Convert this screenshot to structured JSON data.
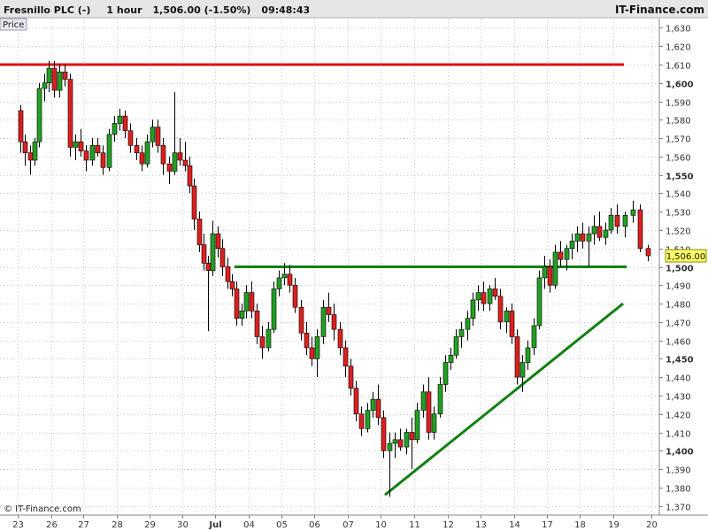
{
  "header": {
    "instrument": "Fresnillo PLC (-)",
    "timeframe": "1 hour",
    "last_price": "1,506.00 (-1.50%)",
    "time": "09:48:43",
    "brand": "IT-Finance.com"
  },
  "panel_label": "Price",
  "watermark": "© IT-Finance.com",
  "price_badge": "1,506.00",
  "colors": {
    "up_candle": "#22a022",
    "down_candle": "#dd2020",
    "resistance_line": "#e01010",
    "support_line": "#108010",
    "trend_line": "#108010",
    "grid": "#c8c8c8",
    "axis_text": "#333333"
  },
  "chart_data": {
    "type": "candlestick",
    "ylim": [
      1365,
      1635
    ],
    "y_ticks": [
      {
        "value": 1370,
        "label": "1,370",
        "bold": false
      },
      {
        "value": 1380,
        "label": "1,380",
        "bold": false
      },
      {
        "value": 1390,
        "label": "1,390",
        "bold": false
      },
      {
        "value": 1400,
        "label": "1,400",
        "bold": true
      },
      {
        "value": 1410,
        "label": "1,410",
        "bold": false
      },
      {
        "value": 1420,
        "label": "1,420",
        "bold": false
      },
      {
        "value": 1430,
        "label": "1,430",
        "bold": false
      },
      {
        "value": 1440,
        "label": "1,440",
        "bold": false
      },
      {
        "value": 1450,
        "label": "1,450",
        "bold": true
      },
      {
        "value": 1460,
        "label": "1,460",
        "bold": false
      },
      {
        "value": 1470,
        "label": "1,470",
        "bold": false
      },
      {
        "value": 1480,
        "label": "1,480",
        "bold": false
      },
      {
        "value": 1490,
        "label": "1,490",
        "bold": false
      },
      {
        "value": 1500,
        "label": "1,500",
        "bold": true
      },
      {
        "value": 1510,
        "label": "1,510",
        "bold": false
      },
      {
        "value": 1520,
        "label": "1,520",
        "bold": false
      },
      {
        "value": 1530,
        "label": "1,530",
        "bold": false
      },
      {
        "value": 1540,
        "label": "1,540",
        "bold": false
      },
      {
        "value": 1550,
        "label": "1,550",
        "bold": true
      },
      {
        "value": 1560,
        "label": "1,560",
        "bold": false
      },
      {
        "value": 1570,
        "label": "1,570",
        "bold": false
      },
      {
        "value": 1580,
        "label": "1,580",
        "bold": false
      },
      {
        "value": 1590,
        "label": "1,590",
        "bold": false
      },
      {
        "value": 1600,
        "label": "1,600",
        "bold": true
      },
      {
        "value": 1610,
        "label": "1,610",
        "bold": false
      },
      {
        "value": 1620,
        "label": "1,620",
        "bold": false
      },
      {
        "value": 1630,
        "label": "1,630",
        "bold": false
      }
    ],
    "x_labels": [
      "23",
      "26",
      "27",
      "28",
      "29",
      "30",
      "Jul",
      "04",
      "05",
      "06",
      "07",
      "10",
      "11",
      "12",
      "13",
      "14",
      "17",
      "18",
      "19",
      "20"
    ],
    "sessions": [
      {
        "label": "23",
        "ohlc": [
          [
            1585,
            1588,
            1562,
            1568
          ],
          [
            1568,
            1572,
            1555,
            1562
          ],
          [
            1562,
            1566,
            1550,
            1558
          ],
          [
            1558,
            1570,
            1555,
            1568
          ],
          [
            1568,
            1600,
            1565,
            1597
          ],
          [
            1597,
            1605,
            1590,
            1600
          ],
          [
            1600,
            1612,
            1595,
            1608
          ]
        ]
      },
      {
        "label": "26",
        "ohlc": [
          [
            1608,
            1612,
            1592,
            1596
          ],
          [
            1596,
            1610,
            1592,
            1606
          ],
          [
            1606,
            1610,
            1598,
            1602
          ],
          [
            1602,
            1605,
            1560,
            1565
          ],
          [
            1565,
            1572,
            1558,
            1568
          ],
          [
            1568,
            1575,
            1560,
            1563
          ]
        ]
      },
      {
        "label": "27",
        "ohlc": [
          [
            1563,
            1566,
            1552,
            1558
          ],
          [
            1558,
            1570,
            1555,
            1566
          ],
          [
            1566,
            1570,
            1560,
            1562
          ],
          [
            1562,
            1566,
            1550,
            1554
          ],
          [
            1554,
            1575,
            1552,
            1572
          ],
          [
            1572,
            1582,
            1568,
            1578
          ]
        ]
      },
      {
        "label": "28",
        "ohlc": [
          [
            1578,
            1586,
            1574,
            1582
          ],
          [
            1582,
            1585,
            1570,
            1574
          ],
          [
            1574,
            1578,
            1562,
            1566
          ],
          [
            1566,
            1570,
            1558,
            1562
          ],
          [
            1562,
            1566,
            1552,
            1556
          ],
          [
            1556,
            1572,
            1554,
            1568
          ]
        ]
      },
      {
        "label": "29",
        "ohlc": [
          [
            1568,
            1580,
            1565,
            1576
          ],
          [
            1576,
            1580,
            1562,
            1566
          ],
          [
            1566,
            1570,
            1550,
            1556
          ],
          [
            1556,
            1560,
            1545,
            1552
          ],
          [
            1552,
            1595,
            1550,
            1562
          ],
          [
            1562,
            1570,
            1555,
            1558
          ]
        ]
      },
      {
        "label": "30",
        "ohlc": [
          [
            1558,
            1568,
            1552,
            1555
          ],
          [
            1555,
            1560,
            1540,
            1544
          ],
          [
            1544,
            1548,
            1520,
            1526
          ],
          [
            1526,
            1530,
            1508,
            1512
          ],
          [
            1512,
            1518,
            1498,
            1502
          ],
          [
            1502,
            1506,
            1465,
            1498
          ],
          [
            1498,
            1525,
            1495,
            1518
          ]
        ]
      },
      {
        "label": "Jul",
        "ohlc": [
          [
            1518,
            1522,
            1505,
            1510
          ],
          [
            1510,
            1515,
            1495,
            1500
          ],
          [
            1500,
            1505,
            1488,
            1492
          ],
          [
            1492,
            1496,
            1484,
            1488
          ],
          [
            1488,
            1492,
            1468,
            1472
          ],
          [
            1472,
            1480,
            1468,
            1476
          ],
          [
            1476,
            1490,
            1472,
            1486
          ]
        ]
      },
      {
        "label": "04",
        "ohlc": [
          [
            1486,
            1492,
            1472,
            1476
          ],
          [
            1476,
            1480,
            1458,
            1462
          ],
          [
            1462,
            1468,
            1450,
            1456
          ],
          [
            1456,
            1470,
            1454,
            1466
          ],
          [
            1466,
            1492,
            1464,
            1488
          ],
          [
            1488,
            1498,
            1484,
            1494
          ]
        ]
      },
      {
        "label": "05",
        "ohlc": [
          [
            1494,
            1502,
            1490,
            1496
          ],
          [
            1496,
            1501,
            1486,
            1490
          ],
          [
            1490,
            1494,
            1475,
            1478
          ],
          [
            1478,
            1482,
            1460,
            1464
          ],
          [
            1464,
            1470,
            1452,
            1456
          ],
          [
            1456,
            1462,
            1446,
            1450
          ]
        ]
      },
      {
        "label": "06",
        "ohlc": [
          [
            1450,
            1466,
            1440,
            1462
          ],
          [
            1462,
            1482,
            1458,
            1478
          ],
          [
            1478,
            1486,
            1470,
            1474
          ],
          [
            1474,
            1480,
            1460,
            1466
          ],
          [
            1466,
            1470,
            1452,
            1456
          ],
          [
            1456,
            1460,
            1440,
            1446
          ]
        ]
      },
      {
        "label": "07",
        "ohlc": [
          [
            1446,
            1450,
            1430,
            1434
          ],
          [
            1434,
            1438,
            1416,
            1420
          ],
          [
            1420,
            1424,
            1408,
            1412
          ],
          [
            1412,
            1426,
            1410,
            1422
          ],
          [
            1422,
            1432,
            1418,
            1428
          ],
          [
            1428,
            1436,
            1414,
            1418
          ]
        ]
      },
      {
        "label": "10",
        "ohlc": [
          [
            1418,
            1422,
            1396,
            1400
          ],
          [
            1400,
            1410,
            1375,
            1404
          ],
          [
            1404,
            1410,
            1396,
            1406
          ],
          [
            1406,
            1412,
            1400,
            1402
          ],
          [
            1402,
            1412,
            1398,
            1410
          ],
          [
            1410,
            1418,
            1390,
            1406
          ]
        ]
      },
      {
        "label": "11",
        "ohlc": [
          [
            1406,
            1426,
            1404,
            1422
          ],
          [
            1422,
            1436,
            1418,
            1432
          ],
          [
            1432,
            1440,
            1406,
            1410
          ],
          [
            1410,
            1424,
            1406,
            1420
          ],
          [
            1420,
            1440,
            1418,
            1436
          ],
          [
            1436,
            1452,
            1432,
            1448
          ]
        ]
      },
      {
        "label": "12",
        "ohlc": [
          [
            1448,
            1456,
            1444,
            1452
          ],
          [
            1452,
            1466,
            1450,
            1462
          ],
          [
            1462,
            1470,
            1456,
            1466
          ],
          [
            1466,
            1476,
            1460,
            1472
          ],
          [
            1472,
            1486,
            1468,
            1482
          ],
          [
            1482,
            1490,
            1476,
            1486
          ]
        ]
      },
      {
        "label": "13",
        "ohlc": [
          [
            1486,
            1492,
            1476,
            1480
          ],
          [
            1480,
            1490,
            1476,
            1488
          ],
          [
            1488,
            1494,
            1482,
            1484
          ],
          [
            1484,
            1488,
            1466,
            1470
          ],
          [
            1470,
            1478,
            1464,
            1476
          ],
          [
            1476,
            1480,
            1458,
            1462
          ]
        ]
      },
      {
        "label": "14",
        "ohlc": [
          [
            1462,
            1466,
            1436,
            1440
          ],
          [
            1440,
            1452,
            1432,
            1448
          ],
          [
            1448,
            1460,
            1444,
            1456
          ],
          [
            1456,
            1472,
            1452,
            1468
          ],
          [
            1468,
            1498,
            1466,
            1494
          ],
          [
            1494,
            1506,
            1488,
            1500
          ]
        ]
      },
      {
        "label": "17",
        "ohlc": [
          [
            1500,
            1504,
            1486,
            1490
          ],
          [
            1490,
            1512,
            1488,
            1508
          ],
          [
            1508,
            1514,
            1500,
            1504
          ],
          [
            1504,
            1512,
            1498,
            1510
          ],
          [
            1510,
            1518,
            1504,
            1514
          ],
          [
            1514,
            1522,
            1508,
            1518
          ]
        ]
      },
      {
        "label": "18",
        "ohlc": [
          [
            1518,
            1524,
            1510,
            1514
          ],
          [
            1514,
            1522,
            1500,
            1518
          ],
          [
            1518,
            1528,
            1512,
            1522
          ],
          [
            1522,
            1530,
            1514,
            1516
          ],
          [
            1516,
            1524,
            1512,
            1520
          ],
          [
            1520,
            1532,
            1518,
            1528
          ]
        ]
      },
      {
        "label": "19",
        "ohlc": [
          [
            1528,
            1534,
            1518,
            1522
          ],
          [
            1522,
            1530,
            1516,
            1528
          ],
          [
            1528,
            1536,
            1524,
            1531
          ],
          [
            1531,
            1534,
            1508,
            1510
          ],
          [
            1510,
            1512,
            1503,
            1506
          ]
        ]
      }
    ],
    "levels": [
      {
        "kind": "resistance",
        "y": 1610
      },
      {
        "kind": "support",
        "y": 1500
      }
    ],
    "trend_line": {
      "from": {
        "session": "10",
        "y": 1376
      },
      "to": {
        "session": "20",
        "y": 1480
      }
    }
  }
}
